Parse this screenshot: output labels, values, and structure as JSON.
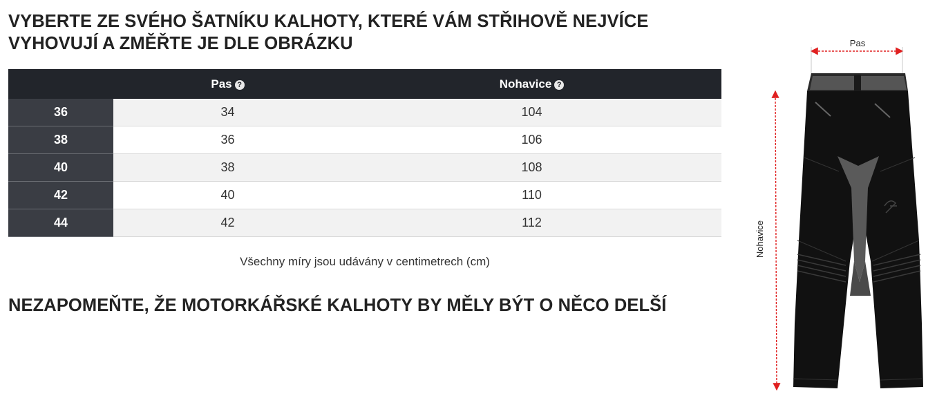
{
  "intro_heading": "VYBERTE ZE SVÉHO ŠATNÍKU KALHOTY, KTERÉ VÁM STŘIHOVĚ NEJVÍCE VYHOVUJÍ A ZMĚŘTE JE DLE OBRÁZKU",
  "table": {
    "columns": [
      {
        "label": "Pas",
        "icon": "help-icon"
      },
      {
        "label": "Nohavice",
        "icon": "help-icon"
      }
    ],
    "rows": [
      {
        "size": "36",
        "pas": "34",
        "nohavice": "104"
      },
      {
        "size": "38",
        "pas": "36",
        "nohavice": "106"
      },
      {
        "size": "40",
        "pas": "38",
        "nohavice": "108"
      },
      {
        "size": "42",
        "pas": "40",
        "nohavice": "110"
      },
      {
        "size": "44",
        "pas": "42",
        "nohavice": "112"
      }
    ]
  },
  "unit_note": "Všechny míry jsou udávány v centimetrech (cm)",
  "reminder_heading": "NEZAPOMEŇTE, ŽE MOTORKÁŘSKÉ KALHOTY BY MĚLY BÝT O NĚCO DELŠÍ",
  "diagram": {
    "waist_label": "Pas",
    "length_label": "Nohavice",
    "arrow_color": "#e02020",
    "trousers_color": "#111111"
  }
}
